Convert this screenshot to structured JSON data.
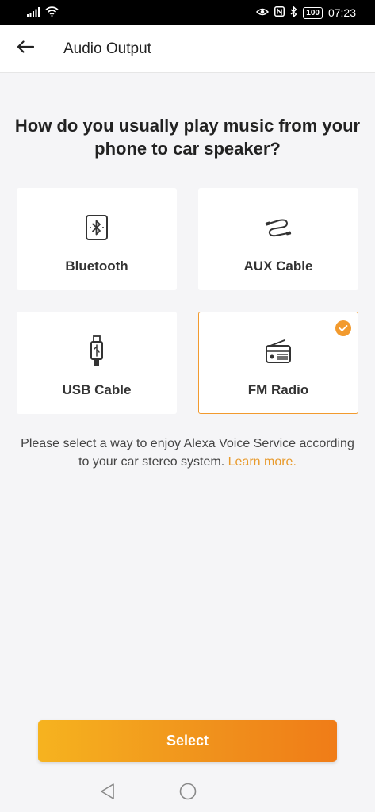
{
  "status_bar": {
    "battery": "100",
    "time": "07:23"
  },
  "header": {
    "title": "Audio Output"
  },
  "question": "How do you usually play music from your phone to car speaker?",
  "options": [
    {
      "label": "Bluetooth",
      "icon": "bluetooth-icon",
      "selected": false
    },
    {
      "label": "AUX Cable",
      "icon": "aux-cable-icon",
      "selected": false
    },
    {
      "label": "USB Cable",
      "icon": "usb-cable-icon",
      "selected": false
    },
    {
      "label": "FM Radio",
      "icon": "radio-icon",
      "selected": true
    }
  ],
  "description": {
    "text": "Please select a way to enjoy Alexa Voice Service according to your car stereo system.",
    "link": "Learn more."
  },
  "select_button": "Select",
  "colors": {
    "accent": "#f29a2e",
    "link": "#e89a2c",
    "button_start": "#f6b31f",
    "button_end": "#f07c17"
  }
}
